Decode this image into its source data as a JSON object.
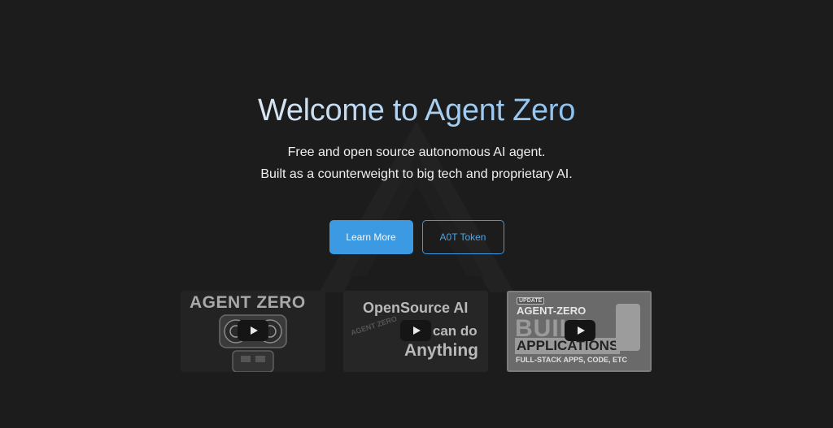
{
  "hero": {
    "title": "Welcome to Agent Zero",
    "subtitle_line1": "Free and open source autonomous AI agent.",
    "subtitle_line2": "Built as a counterweight to big tech and proprietary AI."
  },
  "buttons": {
    "learn_more": "Learn More",
    "token": "A0T Token"
  },
  "videos": [
    {
      "thumb_title": "AGENT ZERO"
    },
    {
      "thumb_line1": "OpenSource AI",
      "thumb_line2": "that can do",
      "thumb_line3": "Anything",
      "thumb_small": "AGENT ZERO"
    },
    {
      "thumb_badge": "UPDATE",
      "thumb_line1": "AGENT-ZERO",
      "thumb_line2": "BUILD",
      "thumb_line3": "APPLICATIONS",
      "thumb_line4": "FULL-STACK APPS, CODE, ETC"
    }
  ],
  "colors": {
    "background": "#1c1c1d",
    "accent": "#3b9ae1"
  },
  "icons": [
    "agent-zero-logo-icon",
    "play-icon"
  ]
}
